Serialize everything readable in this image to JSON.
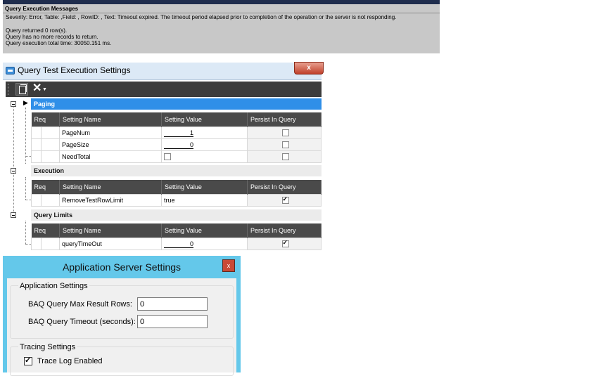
{
  "messages": {
    "title": "Query Execution Messages",
    "lines": [
      "Severity: Error, Table: ,Field: , RowID: , Text: Timeout expired.  The timeout period elapsed prior to completion of the operation or the server is not responding.",
      "",
      "Query returned 0 row(s).",
      "Query has no more records to return.",
      "Query execution total time: 30050.151 ms."
    ]
  },
  "query_settings": {
    "title": "Query Test Execution Settings",
    "close_label": "x",
    "columns": {
      "req": "Req",
      "name": "Setting Name",
      "value": "Setting Value",
      "persist": "Persist In Query"
    },
    "groups": [
      {
        "name": "Paging",
        "rows": [
          {
            "name": "PageNum",
            "value": "1",
            "value_type": "number",
            "persist": false
          },
          {
            "name": "PageSize",
            "value": "0",
            "value_type": "number",
            "persist": false
          },
          {
            "name": "NeedTotal",
            "value": "",
            "value_type": "checkbox",
            "value_checked": false,
            "persist": false
          }
        ]
      },
      {
        "name": "Execution",
        "rows": [
          {
            "name": "RemoveTestRowLimit",
            "value": "true",
            "value_type": "text",
            "persist": true
          }
        ]
      },
      {
        "name": "Query Limits",
        "rows": [
          {
            "name": "queryTimeOut",
            "value": "0",
            "value_type": "number",
            "persist": true
          }
        ]
      }
    ]
  },
  "app_server": {
    "title": "Application Server Settings",
    "close_label": "x",
    "app_settings": {
      "group_label": "Application Settings",
      "max_rows_label": "BAQ Query Max Result Rows:",
      "max_rows_value": "0",
      "timeout_label": "BAQ Query Timeout (seconds):",
      "timeout_value": "0"
    },
    "tracing": {
      "group_label": "Tracing Settings",
      "trace_log_label": "Trace Log Enabled",
      "trace_log_checked": true
    }
  }
}
